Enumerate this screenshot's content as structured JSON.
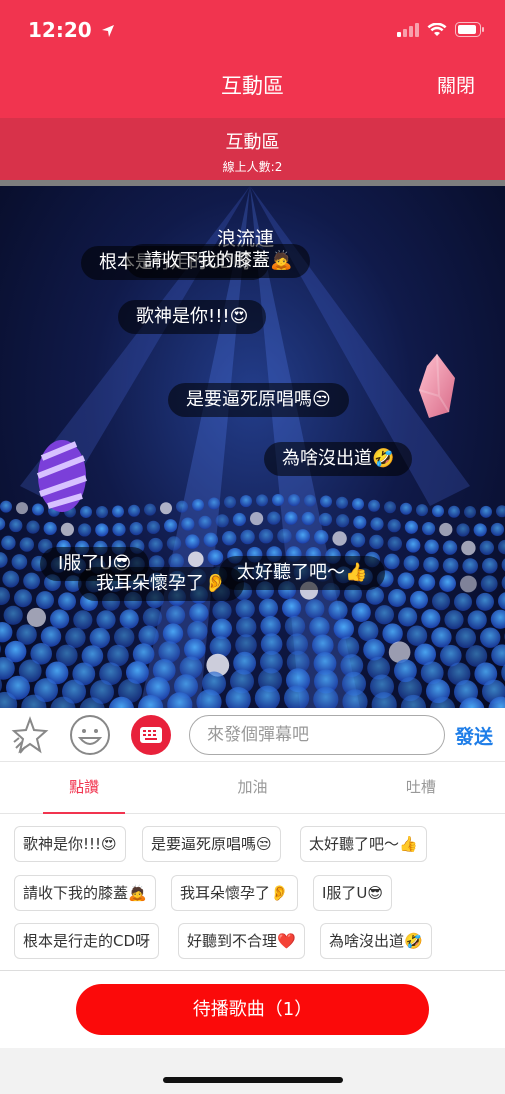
{
  "status": {
    "time": "12:20"
  },
  "nav": {
    "title": "互動區",
    "close": "關閉"
  },
  "room": {
    "title": "互動區",
    "online": "線上人數:2"
  },
  "danmaku": [
    {
      "text": "浪流連"
    },
    {
      "text": "根本是行走的CD呀"
    },
    {
      "text": "請收下我的膝蓋🙇"
    },
    {
      "text": "歌神是你!!!😍"
    },
    {
      "text": "是要逼死原唱嗎😒"
    },
    {
      "text": "為啥沒出道🤣"
    },
    {
      "text": "I服了U😎"
    },
    {
      "text": "我耳朵懷孕了👂"
    },
    {
      "text": "太好聽了吧～👍"
    }
  ],
  "input": {
    "placeholder": "來發個彈幕吧",
    "value": "",
    "send": "發送"
  },
  "tabs": [
    {
      "label": "點讚"
    },
    {
      "label": "加油"
    },
    {
      "label": "吐槽"
    }
  ],
  "phrases": [
    "歌神是你!!!😍",
    "是要逼死原唱嗎😒",
    "太好聽了吧～👍",
    "請收下我的膝蓋🙇",
    "我耳朵懷孕了👂",
    "I服了U😎",
    "根本是行走的CD呀",
    "好聽到不合理❤️",
    "為啥沒出道🤣"
  ],
  "queue_button": "待播歌曲（1）",
  "colors": {
    "brand": "#f1344f",
    "send": "#1f7ee8",
    "queue": "#fb0a0a"
  },
  "icons": [
    "navigation-arrow-icon",
    "signal-icon",
    "wifi-icon",
    "battery-icon",
    "sparkle-icon",
    "smiley-icon",
    "keyboard-icon"
  ]
}
